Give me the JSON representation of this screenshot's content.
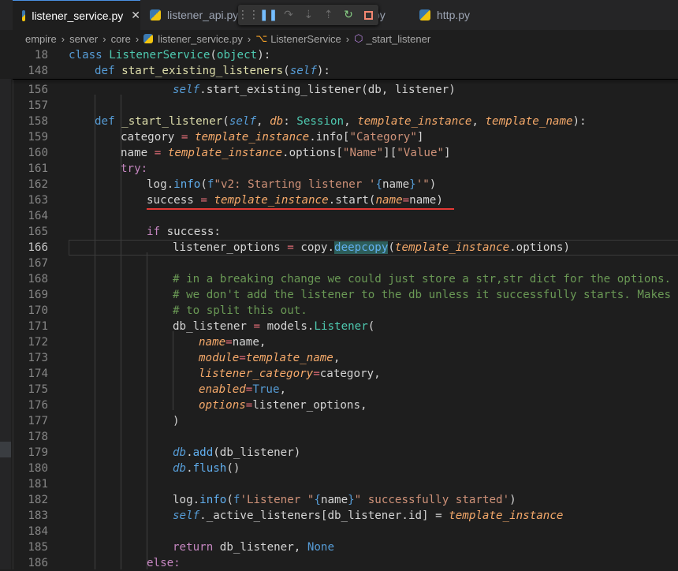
{
  "tabs": [
    {
      "label": "listener_service.py",
      "active": true
    },
    {
      "label": "listener_api.py",
      "active": false
    },
    {
      "label": "py",
      "active": false
    },
    {
      "label": "http.py",
      "active": false
    }
  ],
  "debug_toolbar": {
    "icons": [
      "drag-grip-icon",
      "pause-icon",
      "step-over-icon",
      "step-into-icon",
      "step-out-icon",
      "restart-icon",
      "stop-icon"
    ]
  },
  "breadcrumb": [
    "empire",
    "server",
    "core",
    "listener_service.py",
    "ListenerService",
    "_start_listener"
  ],
  "colors": {
    "keyword": "#569cd6",
    "control": "#c586c0",
    "function": "#dcdcaa",
    "class": "#4ec9b0",
    "string": "#ce9178",
    "comment": "#6a9955",
    "underline": "#e53935"
  },
  "lines": [
    {
      "n": "18"
    },
    {
      "n": "148"
    },
    {
      "n": "156"
    },
    {
      "n": "157"
    },
    {
      "n": "158"
    },
    {
      "n": "159"
    },
    {
      "n": "160"
    },
    {
      "n": "161"
    },
    {
      "n": "162"
    },
    {
      "n": "163"
    },
    {
      "n": "164"
    },
    {
      "n": "165"
    },
    {
      "n": "166"
    },
    {
      "n": "167"
    },
    {
      "n": "168"
    },
    {
      "n": "169"
    },
    {
      "n": "170"
    },
    {
      "n": "171"
    },
    {
      "n": "172"
    },
    {
      "n": "173"
    },
    {
      "n": "174"
    },
    {
      "n": "175"
    },
    {
      "n": "176"
    },
    {
      "n": "177"
    },
    {
      "n": "178"
    },
    {
      "n": "179"
    },
    {
      "n": "180"
    },
    {
      "n": "181"
    },
    {
      "n": "182"
    },
    {
      "n": "183"
    },
    {
      "n": "184"
    },
    {
      "n": "185"
    },
    {
      "n": "186"
    }
  ],
  "code": {
    "l18": {
      "kw": "class",
      "name": "ListenerService",
      "base": "object"
    },
    "l148": {
      "kw": "def",
      "name": "start_existing_listeners",
      "self": "self"
    },
    "l156": {
      "self": "self",
      "rest": ".start_existing_listener(db, listener)"
    },
    "l158": {
      "kw": "def",
      "name": "_start_listener",
      "self": "self",
      "p1": "db",
      "t1": "Session",
      "p2": "template_instance",
      "p3": "template_name"
    },
    "l159": {
      "var": "category",
      "obj": "template_instance",
      "rest": ".info[",
      "str": "\"Category\"",
      "end": "]"
    },
    "l160": {
      "var": "name",
      "obj": "template_instance",
      "rest": ".options[",
      "s1": "\"Name\"",
      "mid": "][",
      "s2": "\"Value\"",
      "end": "]"
    },
    "l161": {
      "kw": "try:"
    },
    "l162": {
      "obj": "log",
      "fn": "info",
      "fpre": "f",
      "s1": "\"v2: Starting listener '",
      "b1": "{",
      "v": "name",
      "b2": "}",
      "s2": "'\""
    },
    "l163": {
      "var": "success",
      "obj": "template_instance",
      "rest": ".start(",
      "kwarg": "name",
      "val": "name",
      "end": ")"
    },
    "l165": {
      "kw": "if",
      "rest": "success:"
    },
    "l166": {
      "var": "listener_options",
      "obj": "copy",
      "fn": "deepcopy",
      "arg": "template_instance",
      "end": ".options)"
    },
    "l168": {
      "comment": "# in a breaking change we could just store a str,str dict for the options."
    },
    "l169": {
      "comment": "# we don't add the listener to the db unless it successfully starts. Makes it"
    },
    "l170": {
      "comment": "# to split this out."
    },
    "l171": {
      "var": "db_listener",
      "obj": "models",
      "cls": "Listener",
      "end": "("
    },
    "l172": {
      "kw": "name",
      "val": "name,"
    },
    "l173": {
      "kw": "module",
      "val": "template_name",
      "end": ","
    },
    "l174": {
      "kw": "listener_category",
      "val": "category,"
    },
    "l175": {
      "kw": "enabled",
      "val": "True",
      "end": ","
    },
    "l176": {
      "kw": "options",
      "val": "listener_options,"
    },
    "l177": {
      "end": ")"
    },
    "l179": {
      "obj": "db",
      "fn": "add",
      "arg": "(db_listener)"
    },
    "l180": {
      "obj": "db",
      "fn": "flush",
      "arg": "()"
    },
    "l182": {
      "obj": "log",
      "fn": "info",
      "fpre": "f",
      "s1": "'Listener \"",
      "b1": "{",
      "v": "name",
      "b2": "}",
      "s2": "\" successfully started'",
      "end": ")"
    },
    "l183": {
      "self": "self",
      "rest": "._active_listeners[db_listener.id] = ",
      "obj": "template_instance"
    },
    "l185": {
      "kw": "return",
      "rest": "db_listener, ",
      "none": "None"
    },
    "l186": {
      "kw": "else:"
    }
  }
}
